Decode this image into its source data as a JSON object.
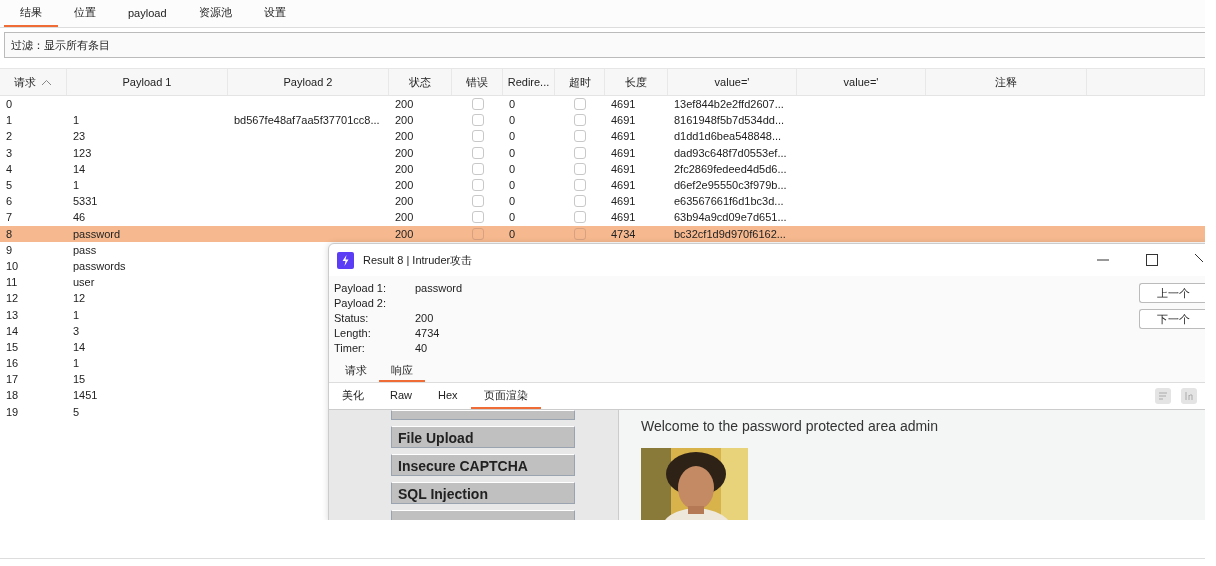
{
  "tabs": [
    {
      "label": "结果",
      "selected": true
    },
    {
      "label": "位置",
      "selected": false
    },
    {
      "label": "payload",
      "selected": false
    },
    {
      "label": "资源池",
      "selected": false
    },
    {
      "label": "设置",
      "selected": false
    }
  ],
  "filter": {
    "label": "过滤：显示所有条目"
  },
  "table": {
    "columns": [
      {
        "label": "请求",
        "sorted": true
      },
      {
        "label": "Payload 1",
        "sorted": false
      },
      {
        "label": "Payload 2",
        "sorted": false
      },
      {
        "label": "状态",
        "sorted": false
      },
      {
        "label": "错误",
        "sorted": false
      },
      {
        "label": "Redire...",
        "sorted": false
      },
      {
        "label": "超时",
        "sorted": false
      },
      {
        "label": "长度",
        "sorted": false
      },
      {
        "label": "value='",
        "sorted": false
      },
      {
        "label": "value='",
        "sorted": false
      },
      {
        "label": "注释",
        "sorted": false
      }
    ],
    "rows": [
      {
        "request": "0",
        "status": "200",
        "error": false,
        "redirects": "0",
        "timeout": false,
        "length": "4691",
        "value_1": "13ef844b2e2ffd2607...",
        "selected": false
      },
      {
        "request": "1",
        "payload_1": "1",
        "payload_2": "bd567fe48af7aa5f37701cc8...",
        "status": "200",
        "error": false,
        "redirects": "0",
        "timeout": false,
        "length": "4691",
        "value_1": "8161948f5b7d534dd...",
        "selected": false
      },
      {
        "request": "2",
        "payload_1": "23",
        "status": "200",
        "error": false,
        "redirects": "0",
        "timeout": false,
        "length": "4691",
        "value_1": "d1dd1d6bea548848...",
        "selected": false
      },
      {
        "request": "3",
        "payload_1": "123",
        "status": "200",
        "error": false,
        "redirects": "0",
        "timeout": false,
        "length": "4691",
        "value_1": "dad93c648f7d0553ef...",
        "selected": false
      },
      {
        "request": "4",
        "payload_1": "14",
        "status": "200",
        "error": false,
        "redirects": "0",
        "timeout": false,
        "length": "4691",
        "value_1": "2fc2869fedeed4d5d6...",
        "selected": false
      },
      {
        "request": "5",
        "payload_1": "1",
        "status": "200",
        "error": false,
        "redirects": "0",
        "timeout": false,
        "length": "4691",
        "value_1": "d6ef2e95550c3f979b...",
        "selected": false
      },
      {
        "request": "6",
        "payload_1": "5331",
        "status": "200",
        "error": false,
        "redirects": "0",
        "timeout": false,
        "length": "4691",
        "value_1": "e63567661f6d1bc3d...",
        "selected": false
      },
      {
        "request": "7",
        "payload_1": "46",
        "status": "200",
        "error": false,
        "redirects": "0",
        "timeout": false,
        "length": "4691",
        "value_1": "63b94a9cd09e7d651...",
        "selected": false
      },
      {
        "request": "8",
        "payload_1": "password",
        "status": "200",
        "error": false,
        "redirects": "0",
        "timeout": false,
        "length": "4734",
        "value_1": "bc32cf1d9d970f6162...",
        "selected": true
      },
      {
        "request": "9",
        "payload_1": "pass",
        "selected": false
      },
      {
        "request": "10",
        "payload_1": "passwords",
        "selected": false
      },
      {
        "request": "11",
        "payload_1": "user",
        "selected": false
      },
      {
        "request": "12",
        "payload_1": "12",
        "selected": false
      },
      {
        "request": "13",
        "payload_1": "1",
        "selected": false
      },
      {
        "request": "14",
        "payload_1": "3",
        "selected": false
      },
      {
        "request": "15",
        "payload_1": "14",
        "selected": false
      },
      {
        "request": "16",
        "payload_1": "1",
        "selected": false
      },
      {
        "request": "17",
        "payload_1": "15",
        "selected": false
      },
      {
        "request": "18",
        "payload_1": "1451",
        "selected": false
      },
      {
        "request": "19",
        "payload_1": "5",
        "selected": false
      }
    ]
  },
  "result_dialog": {
    "title": "Result 8 | Intruder攻击",
    "fields": [
      {
        "label": "Payload 1:",
        "value": "password"
      },
      {
        "label": "Payload 2:"
      },
      {
        "label": "Status:",
        "value": "200"
      },
      {
        "label": "Length:",
        "value": "4734"
      },
      {
        "label": "Timer:",
        "value": "40"
      }
    ],
    "buttons": [
      "上一个",
      "下一个"
    ],
    "tabs": [
      {
        "label": "请求",
        "selected": false
      },
      {
        "label": "响应",
        "selected": true
      }
    ],
    "view_tabs": [
      {
        "label": "美化",
        "selected": false
      },
      {
        "label": "Raw",
        "selected": false
      },
      {
        "label": "Hex",
        "selected": false
      },
      {
        "label": "页面渲染",
        "selected": true
      }
    ],
    "rendered_page": {
      "menu": [
        "File Upload",
        "Insecure CAPTCHA",
        "SQL Injection"
      ],
      "welcome": "Welcome to the password protected area admin"
    }
  }
}
